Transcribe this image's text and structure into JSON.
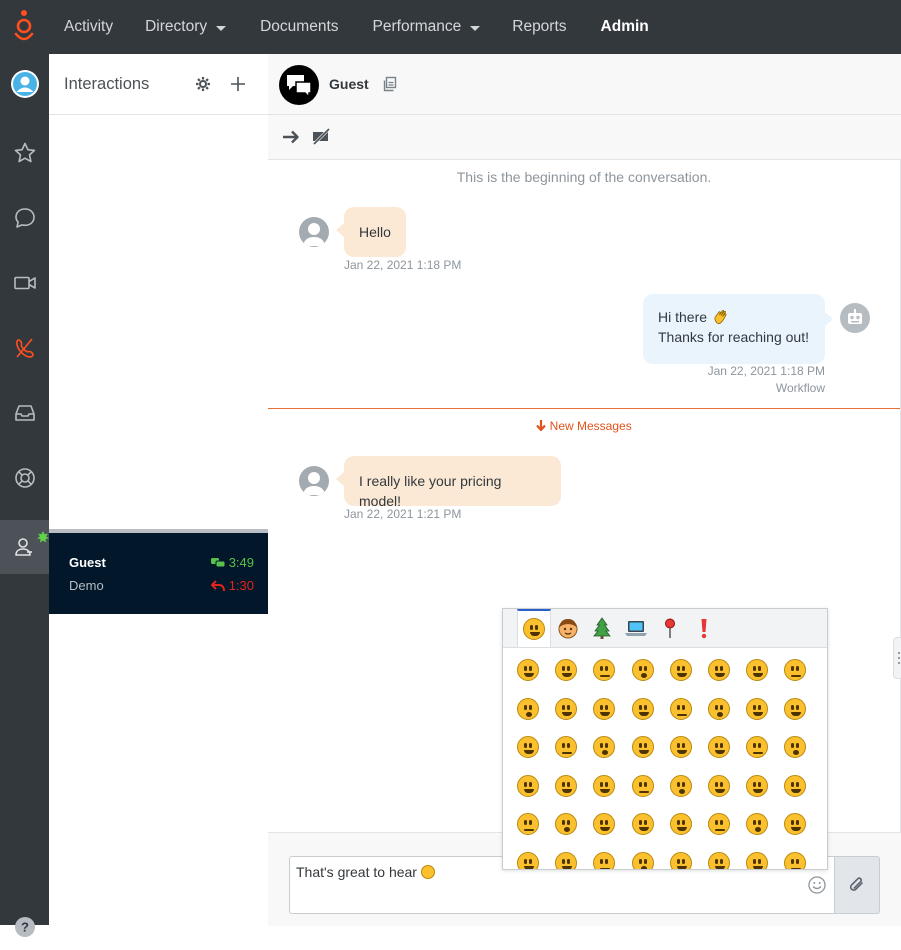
{
  "nav": {
    "items": [
      {
        "label": "Activity",
        "has_menu": false
      },
      {
        "label": "Directory",
        "has_menu": true
      },
      {
        "label": "Documents",
        "has_menu": false
      },
      {
        "label": "Performance",
        "has_menu": true
      },
      {
        "label": "Reports",
        "has_menu": false
      },
      {
        "label": "Admin",
        "has_menu": false,
        "active": true
      }
    ]
  },
  "rail": {
    "items": [
      "user-avatar-icon",
      "star-icon",
      "chat-icon",
      "video-icon",
      "phone-off-icon",
      "inbox-icon",
      "help-ring-icon",
      "agent-status-icon",
      "question-icon"
    ],
    "active": "agent-status-icon",
    "presence_color": "#5fd34a"
  },
  "interactions": {
    "title": "Interactions",
    "card": {
      "name": "Guest",
      "subtitle": "Demo",
      "chat_time": "3:49",
      "reply_time": "1:30"
    }
  },
  "conversation": {
    "header_name": "Guest",
    "beginning_text": "This is the beginning of the conversation.",
    "messages": [
      {
        "direction": "in",
        "text": "Hello",
        "timestamp": "Jan 22, 2021 1:18 PM"
      },
      {
        "direction": "out",
        "line1": "Hi there",
        "line2": "Thanks for reaching out!",
        "timestamp": "Jan 22, 2021 1:18 PM",
        "sender": "Workflow"
      },
      {
        "direction": "in",
        "text": "I really like your pricing model!",
        "timestamp": "Jan 22, 2021 1:21 PM"
      }
    ],
    "new_messages_label": "New Messages",
    "composer_text": "That's great to hear"
  },
  "emoji_picker": {
    "tabs": [
      "smileys",
      "people",
      "nature",
      "objects",
      "places",
      "symbols"
    ],
    "active_tab": "smileys",
    "rows": 6,
    "cols": 8
  },
  "colors": {
    "topbar": "#33383d",
    "incoming_bubble": "#fbe9d5",
    "outgoing_bubble": "#eaf4fd",
    "new_messages": "#e0531c",
    "card_bg": "#02172a",
    "timer_green": "#58c14a",
    "timer_red": "#e0251d"
  }
}
